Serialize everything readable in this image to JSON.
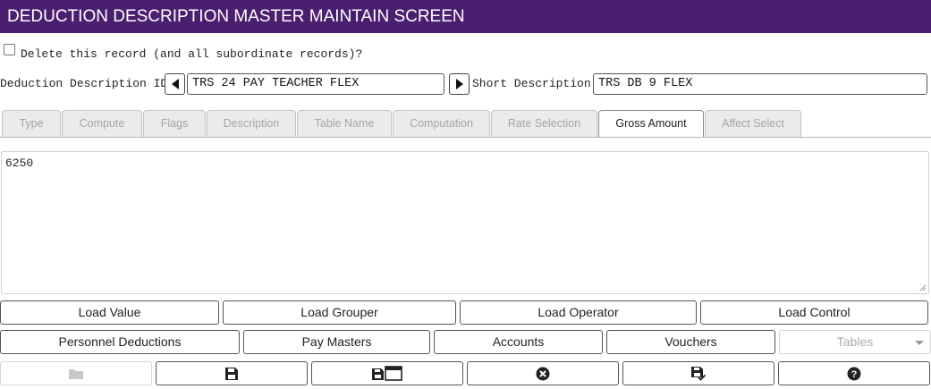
{
  "window": {
    "title": "DEDUCTION DESCRIPTION MASTER MAINTAIN SCREEN"
  },
  "delete_record": {
    "label": "Delete this record (and all subordinate records)?",
    "checked": false
  },
  "deduction_id": {
    "label": "Deduction Description ID:",
    "value": "TRS 24 PAY TEACHER FLEX"
  },
  "short_description": {
    "label": "Short Description:",
    "value": "TRS DB 9 FLEX"
  },
  "tabs": [
    {
      "label": "Type"
    },
    {
      "label": "Compute"
    },
    {
      "label": "Flags"
    },
    {
      "label": "Description"
    },
    {
      "label": "Table Name"
    },
    {
      "label": "Computation"
    },
    {
      "label": "Rate Selection"
    },
    {
      "label": "Gross Amount",
      "active": true
    },
    {
      "label": "Affect Select"
    }
  ],
  "gross_amount": {
    "value": "6250"
  },
  "load_buttons": [
    {
      "label": "Load Value"
    },
    {
      "label": "Load Grouper"
    },
    {
      "label": "Load Operator"
    },
    {
      "label": "Load Control"
    }
  ],
  "nav_buttons": [
    {
      "label": "Personnel Deductions"
    },
    {
      "label": "Pay Masters"
    },
    {
      "label": "Accounts"
    },
    {
      "label": "Vouchers"
    }
  ],
  "tables_select": {
    "label": "Tables",
    "enabled": false
  },
  "toolbar": [
    {
      "icon": "folder-icon",
      "enabled": false
    },
    {
      "icon": "save-icon",
      "enabled": true
    },
    {
      "icon": "save-and-new-window-icon",
      "enabled": true
    },
    {
      "icon": "close-circle-icon",
      "enabled": true
    },
    {
      "icon": "save-check-icon",
      "enabled": true
    },
    {
      "icon": "help-icon",
      "enabled": true
    }
  ],
  "colors": {
    "title_bar": "#4b1f6f",
    "title_text": "#ffffff"
  }
}
